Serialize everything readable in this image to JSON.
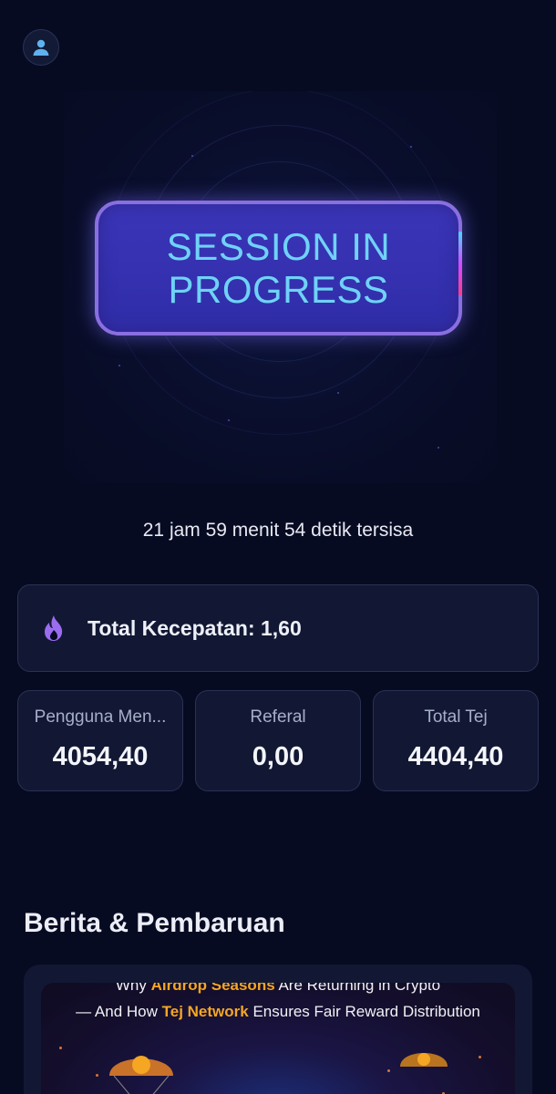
{
  "header": {
    "profile_icon": "user-avatar-icon"
  },
  "session": {
    "button_label": "SESSION IN PROGRESS"
  },
  "timer": {
    "text": "21 jam 59 menit 54 detik tersisa"
  },
  "speed": {
    "icon": "flame-icon",
    "label": "Total Kecepatan: 1,60"
  },
  "stats": [
    {
      "label": "Pengguna Men...",
      "value": "4054,40"
    },
    {
      "label": "Referal",
      "value": "0,00"
    },
    {
      "label": "Total Tej",
      "value": "4404,40"
    }
  ],
  "news": {
    "section_title": "Berita & Pembaruan",
    "headline_line1_pre": "Why ",
    "headline_line1_hl": "Airdrop Seasons",
    "headline_line1_post": " Are Returning in Crypto",
    "headline_line2_pre": "— And How ",
    "headline_line2_hl": "Tej Network",
    "headline_line2_post": " Ensures Fair Reward Distribution"
  },
  "colors": {
    "background": "#070b22",
    "button_fill": "#3a35b8",
    "button_text": "#6fd2f6",
    "accent_orange": "#f5a623",
    "flame": "#9b6cf0"
  }
}
